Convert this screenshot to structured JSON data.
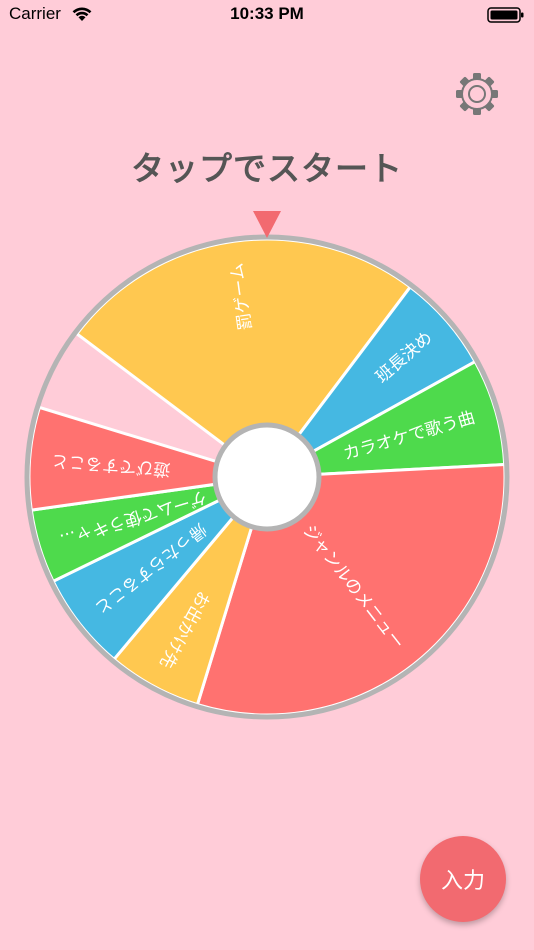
{
  "status_bar": {
    "carrier": "Carrier",
    "time": "10:33 PM"
  },
  "title": "タップでスタート",
  "settings_icon": "gear-icon",
  "input_button_label": "入力",
  "colors": {
    "background": "#FFCCD8",
    "yellow": "#FFC850",
    "blue": "#45B8E2",
    "green": "#4EDA4C",
    "red": "#FF7270",
    "pointer": "#F26A70",
    "wheel_border": "#B4B4B4",
    "title": "#555555"
  },
  "roulette": {
    "segments": [
      {
        "label": "罰ゲーム",
        "color": "yellow"
      },
      {
        "label": "班長決め",
        "color": "blue"
      },
      {
        "label": "カラオケで歌う曲",
        "color": "green"
      },
      {
        "label": "ジャンルのメニュー",
        "color": "red"
      },
      {
        "label": "お出かけ先",
        "color": "yellow"
      },
      {
        "label": "帰ったらすること",
        "color": "blue"
      },
      {
        "label": "ゲームで使うキャ...",
        "color": "green"
      },
      {
        "label": "遊びですること",
        "color": "red"
      }
    ]
  }
}
